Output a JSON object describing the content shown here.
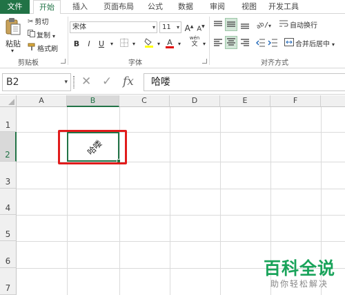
{
  "tabs": [
    "文件",
    "开始",
    "插入",
    "页面布局",
    "公式",
    "数据",
    "审阅",
    "视图",
    "开发工具"
  ],
  "clipboard": {
    "paste_label": "粘贴",
    "cut_label": "剪切",
    "copy_label": "复制",
    "format_painter_label": "格式刷",
    "group_label": "剪贴板"
  },
  "font": {
    "font_name": "宋体",
    "font_size": "11",
    "grow_label": "A",
    "shrink_label": "A",
    "bold_label": "B",
    "italic_label": "I",
    "underline_label": "U",
    "font_color_label": "A",
    "phonetic_label": "wén",
    "phonetic_sub": "文",
    "group_label": "字体"
  },
  "alignment": {
    "wrap_text_label": "自动换行",
    "merge_center_label": "合并后居中",
    "group_label": "对齐方式"
  },
  "name_box": "B2",
  "formula_bar": {
    "fx_label": "fx",
    "value": "哈喽"
  },
  "grid": {
    "columns": [
      "A",
      "B",
      "C",
      "D",
      "E",
      "F"
    ],
    "rows": [
      "1",
      "2",
      "3",
      "4",
      "5",
      "6",
      "7"
    ],
    "selected_column": "B",
    "selected_row": "2",
    "active_cell_text": "哈喽"
  },
  "watermark": {
    "title": "百科全说",
    "subtitle": "助你轻松解决"
  },
  "colors": {
    "accent": "#217346",
    "highlight_box": "#e11b1b",
    "watermark": "#19a35a"
  }
}
